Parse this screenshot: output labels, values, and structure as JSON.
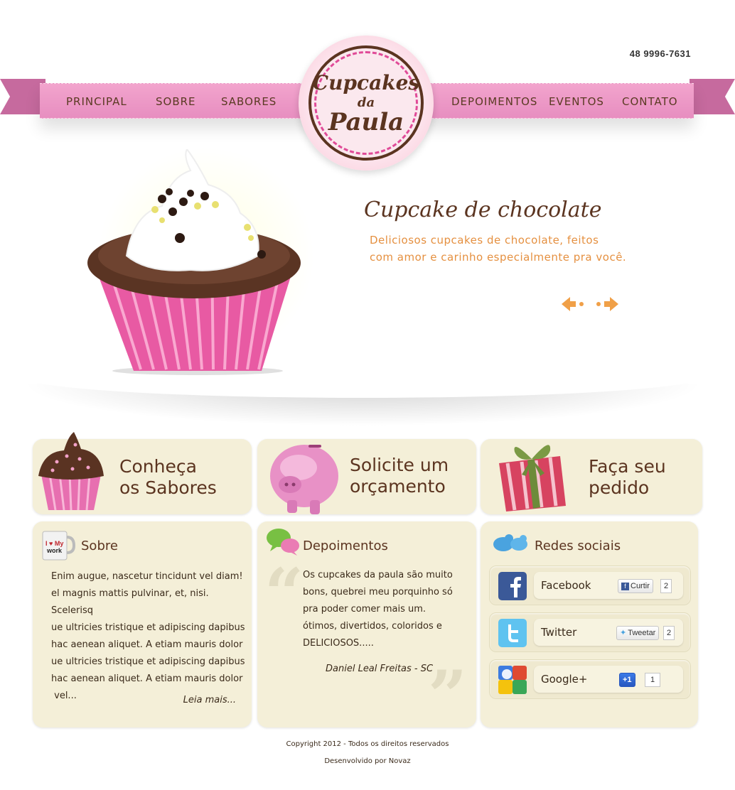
{
  "header": {
    "phone": "48 9996-7631",
    "logo_line1": "Cupcakes",
    "logo_line2": "da",
    "logo_line3": "Paula",
    "nav": [
      "PRINCIPAL",
      "SOBRE",
      "SABORES",
      "DEPOIMENTOS",
      "EVENTOS",
      "CONTATO"
    ]
  },
  "hero": {
    "title": "Cupcake de chocolate",
    "desc_line1": "Deliciosos cupcakes de chocolate, feitos",
    "desc_line2": "com amor e carinho especialmente pra você.",
    "prev_icon": "arrow-left-icon",
    "next_icon": "arrow-right-icon"
  },
  "features": [
    {
      "line1": "Conheça",
      "line2": "os Sabores",
      "icon": "cupcake-icon"
    },
    {
      "line1": "Solicite um",
      "line2": "orçamento",
      "icon": "piggy-bank-icon"
    },
    {
      "line1": "Faça seu",
      "line2": "pedido",
      "icon": "gift-box-icon"
    }
  ],
  "sobre": {
    "title": "Sobre",
    "mug_text_1": "I ♥ My",
    "mug_text_2": "work",
    "lines": [
      "Enim augue, nascetur tincidunt vel diam!",
      "el magnis mattis pulvinar, et, nisi. Scelerisq",
      "ue ultricies tristique et adipiscing dapibus",
      "hac aenean aliquet. A etiam mauris dolor",
      "ue ultricies tristique et adipiscing dapibus",
      "hac aenean aliquet. A etiam mauris dolor",
      " vel..."
    ],
    "more": "Leia mais..."
  },
  "depoimentos": {
    "title": "Depoimentos",
    "lines": [
      "Os cupcakes da paula são muito",
      "bons, quebrei meu porquinho só",
      "pra poder comer mais um.",
      "ótimos, divertidos, coloridos e",
      "DELICIOSOS....."
    ],
    "author": "Daniel Leal Freitas - SC"
  },
  "redes": {
    "title": "Redes sociais",
    "items": [
      {
        "name": "Facebook",
        "button": "Curtir",
        "count": "2",
        "icon": "facebook-icon"
      },
      {
        "name": "Twitter",
        "button": "Tweetar",
        "count": "2",
        "icon": "twitter-icon"
      },
      {
        "name": "Google+",
        "button": "+1",
        "count": "1",
        "icon": "google-plus-icon"
      }
    ]
  },
  "footer": {
    "copyright": "Copyright 2012 - Todos os direitos reservados",
    "dev": "Desenvolvido por Novaz"
  },
  "colors": {
    "accent_pink": "#e78ec0",
    "brown": "#5b3420",
    "orange": "#e59040",
    "panel_bg": "#f4efd8"
  }
}
